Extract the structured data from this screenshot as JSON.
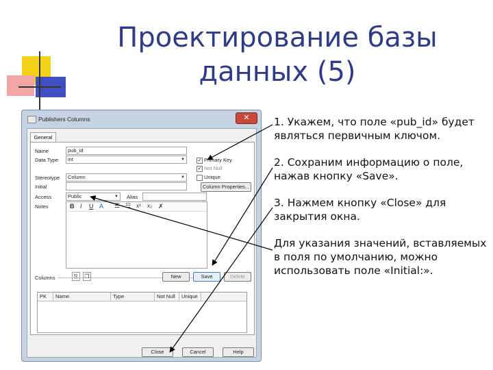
{
  "slide": {
    "title_line1": "Проектирование базы",
    "title_line2": "данных (5)",
    "bullets": [
      "1. Укажем, что поле «pub_id» будет являться первичным ключом.",
      "2. Сохраним информацию о поле, нажав кнопку «Save».",
      "3. Нажмем кнопку «Close» для закрытия окна.",
      "Для указания значений, вставляемых в поля по умолчанию, можно использовать поле «Initial:»."
    ]
  },
  "dialog": {
    "title": "Publishers Columns",
    "close_icon": "close-x-icon",
    "tab_general": "General",
    "name_label": "Name",
    "name_value": "pub_id",
    "datatype_label": "Data Type",
    "datatype_value": "int",
    "stereotype_label": "Stereotype",
    "stereotype_value": "Column",
    "initial_label": "Initial",
    "initial_value": "",
    "access_label": "Access",
    "access_value": "Public",
    "alias_label": "Alias",
    "alias_value": "",
    "notes_label": "Notes",
    "primary_key_label": "Primary Key",
    "primary_key_checked": true,
    "not_null_label": "Not Null",
    "not_null_checked": true,
    "unique_label": "Unique",
    "unique_checked": false,
    "column_properties_label": "Column Properties...",
    "notes_toolbar": {
      "bold": "B",
      "italic": "I",
      "underline": "U",
      "font_color": "A",
      "bullets": "☰",
      "numbering": "☷",
      "superscript": "x²",
      "subscript": "x₂",
      "clear": "✗"
    },
    "columns_label": "Columns",
    "new_label": "New",
    "save_label": "Save",
    "delete_label": "Delete",
    "grid_headers": [
      "PK",
      "Name",
      "Type",
      "Not Null",
      "Unique"
    ],
    "close_label": "Close",
    "cancel_label": "Cancel",
    "help_label": "Help"
  },
  "colors": {
    "title": "#2e3a8c",
    "deco_yellow": "#f5d21a",
    "deco_blue": "#3f4fc0",
    "deco_red": "#e84a4a"
  }
}
